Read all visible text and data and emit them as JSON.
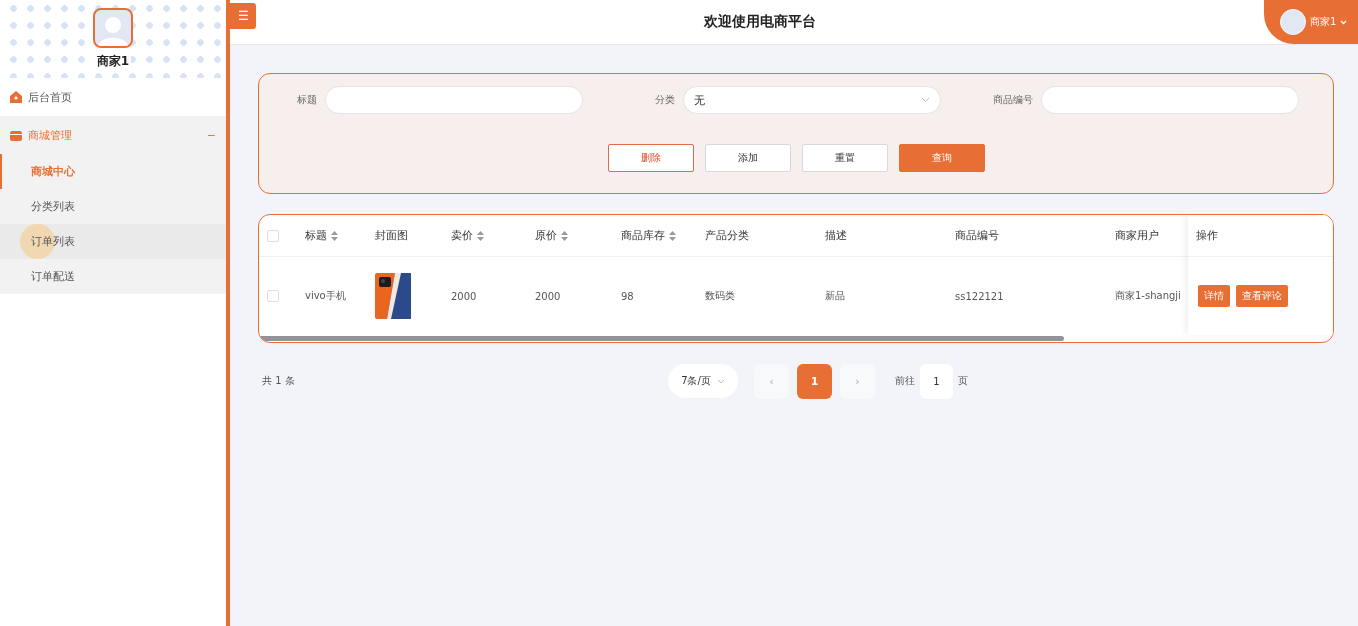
{
  "sidebar": {
    "user_name": "商家1",
    "items": [
      {
        "label": "后台首页",
        "expanded": false
      },
      {
        "label": "商城管理",
        "expanded": true,
        "toggle": "−",
        "children": [
          {
            "label": "商城中心",
            "selected": true,
            "hovered": false
          },
          {
            "label": "分类列表",
            "selected": false,
            "hovered": false
          },
          {
            "label": "订单列表",
            "selected": false,
            "hovered": true
          },
          {
            "label": "订单配送",
            "selected": false,
            "hovered": false
          }
        ]
      }
    ]
  },
  "header": {
    "menu_button": "☰",
    "title": "欢迎使用电商平台",
    "user_name": "商家1"
  },
  "search": {
    "fields": [
      {
        "label": "标题",
        "kind": "input"
      },
      {
        "label": "分类",
        "kind": "select",
        "value": "无"
      },
      {
        "label": "商品编号",
        "kind": "input"
      }
    ],
    "buttons": [
      {
        "label": "删除",
        "kind": "danger"
      },
      {
        "label": "添加",
        "kind": "plain"
      },
      {
        "label": "重置",
        "kind": "plain"
      },
      {
        "label": "查询",
        "kind": "primary"
      }
    ]
  },
  "table": {
    "all_checked": false,
    "columns": [
      {
        "label": "标题",
        "sortable": true
      },
      {
        "label": "封面图",
        "sortable": false
      },
      {
        "label": "卖价",
        "sortable": true
      },
      {
        "label": "原价",
        "sortable": true
      },
      {
        "label": "商品库存",
        "sortable": true
      },
      {
        "label": "产品分类",
        "sortable": false
      },
      {
        "label": "描述",
        "sortable": false
      },
      {
        "label": "商品编号",
        "sortable": false
      },
      {
        "label": "商家用户",
        "sortable": false
      },
      {
        "label": "操作",
        "sortable": false
      }
    ],
    "rows": [
      {
        "checked": false,
        "cells": [
          "vivo手机",
          {
            "kind": "picture"
          },
          "2000",
          "2000",
          "98",
          "数码类",
          "新品",
          "ss122121",
          "商家1-shangji"
        ],
        "actions": [
          "详情",
          "查看评论"
        ]
      }
    ]
  },
  "pagination": {
    "total": "共 1 条",
    "page_size": "7条/页",
    "prev": "‹",
    "pages": [
      {
        "label": "1",
        "selected": true
      }
    ],
    "next": "›",
    "goto_label": "前往",
    "goto_value": "1",
    "goto_unit": "页"
  }
}
